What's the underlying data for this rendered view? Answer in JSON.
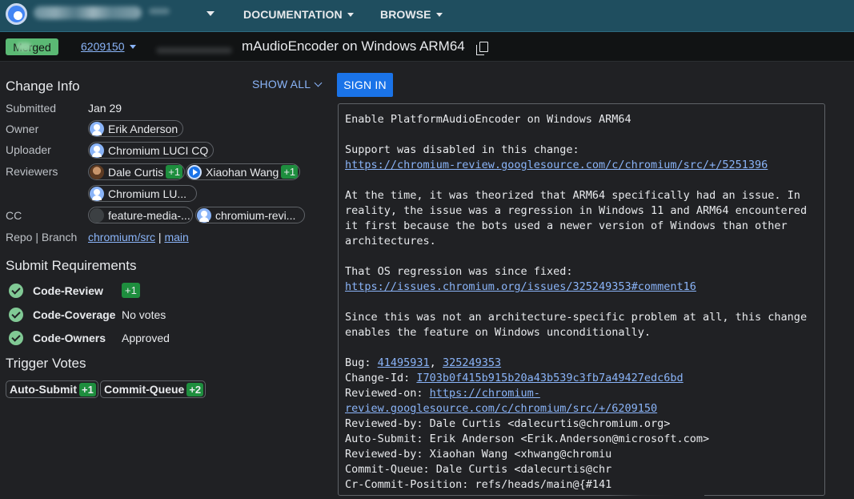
{
  "header": {
    "nav": [
      {
        "label": "DOCUMENTATION"
      },
      {
        "label": "BROWSE"
      }
    ]
  },
  "change": {
    "status": "Merged",
    "number": "6209150",
    "title": "mAudioEncoder on Windows ARM64"
  },
  "change_info": {
    "heading": "Change Info",
    "show_all": "SHOW ALL",
    "sign_in": "SIGN IN",
    "labels": {
      "submitted": "Submitted",
      "owner": "Owner",
      "uploader": "Uploader",
      "reviewers": "Reviewers",
      "cc": "CC",
      "repo_branch": "Repo | Branch"
    },
    "submitted": "Jan 29",
    "owner": "Erik Anderson",
    "uploader": "Chromium LUCI CQ",
    "reviewers": [
      {
        "name": "Dale Curtis",
        "vote": "+1"
      },
      {
        "name": "Xiaohan Wang",
        "vote": "+1"
      },
      {
        "name": "Chromium LU...",
        "vote": ""
      }
    ],
    "cc": [
      "feature-media-...",
      "chromium-revi..."
    ],
    "repo": "chromium/src",
    "separator": "|",
    "branch": "main"
  },
  "submit_requirements": {
    "heading": "Submit Requirements",
    "items": [
      {
        "name": "Code-Review",
        "value": "+1"
      },
      {
        "name": "Code-Coverage",
        "value": "No votes"
      },
      {
        "name": "Code-Owners",
        "value": "Approved"
      }
    ]
  },
  "trigger_votes": {
    "heading": "Trigger Votes",
    "items": [
      {
        "name": "Auto-Submit",
        "vote": "+1"
      },
      {
        "name": "Commit-Queue",
        "vote": "+2"
      }
    ]
  },
  "commit_message": {
    "line1": "Enable PlatformAudioEncoder on Windows ARM64",
    "line2": "Support was disabled in this change:",
    "link1": "https://chromium-review.googlesource.com/c/chromium/src/+/5251396",
    "para2": "At the time, it was theorized that ARM64 specifically had an issue. In\nreality, the issue was a regression in Windows 11 and ARM64 encountered\nit first because the bots used a newer version of Windows than other\narchitectures.",
    "line3": "That OS regression was since fixed:",
    "link2": "https://issues.chromium.org/issues/325249353#comment16",
    "para3": "Since this was not an architecture-specific problem at all, this change\nenables the feature on Windows unconditionally.",
    "bug_label": "Bug: ",
    "bug1": "41495931",
    "bug_sep": ", ",
    "bug2": "325249353",
    "change_id_label": "Change-Id: ",
    "change_id": "I703b0f415b915b20a43b539c3fb7a49427edc6bd",
    "reviewed_on_label": "Reviewed-on: ",
    "reviewed_on_1": "https://chromium-",
    "reviewed_on_2": "review.googlesource.com/c/chromium/src/+/6209150",
    "trailers": "Reviewed-by: Dale Curtis <dalecurtis@chromium.org>\nAuto-Submit: Erik Anderson <Erik.Anderson@microsoft.com>\nReviewed-by: Xiaohan Wang <xhwang@chromiu\nCommit-Queue: Dale Curtis <dalecurtis@chr\nCr-Commit-Position: refs/heads/main@{#141"
  }
}
